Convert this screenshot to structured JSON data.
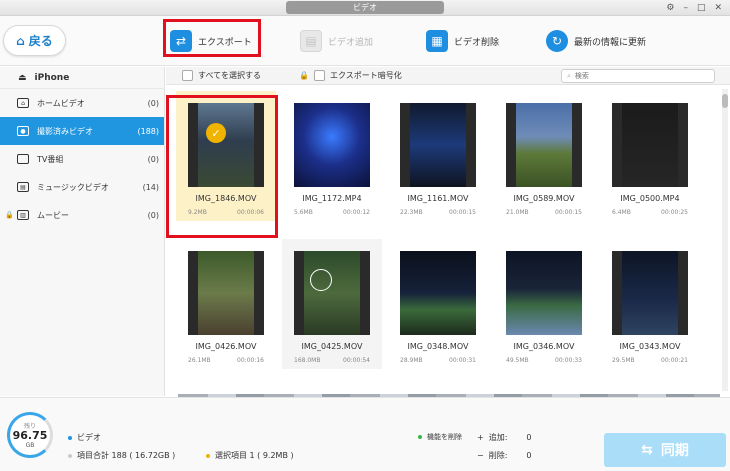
{
  "window": {
    "title": "ビデオ"
  },
  "toolbar": {
    "back_label": "戻る",
    "export_label": "エクスポート",
    "add_label": "ビデオ追加",
    "delete_label": "ビデオ削除",
    "refresh_label": "最新の情報に更新"
  },
  "sidebar": {
    "device": "iPhone",
    "items": [
      {
        "label": "ホームビデオ",
        "count": "(0)"
      },
      {
        "label": "撮影済みビデオ",
        "count": "(188)"
      },
      {
        "label": "TV番組",
        "count": "(0)"
      },
      {
        "label": "ミュージックビデオ",
        "count": "(14)"
      },
      {
        "label": "ムービー",
        "count": "(0)"
      }
    ]
  },
  "filter": {
    "select_all": "すべてを選択する",
    "encrypt": "エクスポート暗号化",
    "search_placeholder": "検索"
  },
  "videos": [
    {
      "name": "IMG_1846.MOV",
      "size": "9.2MB",
      "duration": "00:00:06"
    },
    {
      "name": "IMG_1172.MP4",
      "size": "5.6MB",
      "duration": "00:00:12"
    },
    {
      "name": "IMG_1161.MOV",
      "size": "22.3MB",
      "duration": "00:00:15"
    },
    {
      "name": "IMG_0589.MOV",
      "size": "21.0MB",
      "duration": "00:00:15"
    },
    {
      "name": "IMG_0500.MP4",
      "size": "6.4MB",
      "duration": "00:00:25"
    },
    {
      "name": "IMG_0426.MOV",
      "size": "26.1MB",
      "duration": "00:00:16"
    },
    {
      "name": "IMG_0425.MOV",
      "size": "168.0MB",
      "duration": "00:00:54"
    },
    {
      "name": "IMG_0348.MOV",
      "size": "28.9MB",
      "duration": "00:00:31"
    },
    {
      "name": "IMG_0346.MOV",
      "size": "49.5MB",
      "duration": "00:00:33"
    },
    {
      "name": "IMG_0343.MOV",
      "size": "29.5MB",
      "duration": "00:00:21"
    }
  ],
  "status": {
    "storage_label": "残り",
    "storage_value": "96.75",
    "storage_unit": "GB",
    "category": "ビデオ",
    "total": "項目合計 188 ( 16.72GB )",
    "selected": "選択項目 1 ( 9.2MB )",
    "delete_label": "機能を削除",
    "add_label": "追加:",
    "add_value": "0",
    "remove_label": "削除:",
    "remove_value": "0",
    "sync_label": "同期"
  },
  "colors": {
    "accent": "#2196e0",
    "highlight": "#e0101f",
    "selected_bg": "#fdf2c7"
  }
}
